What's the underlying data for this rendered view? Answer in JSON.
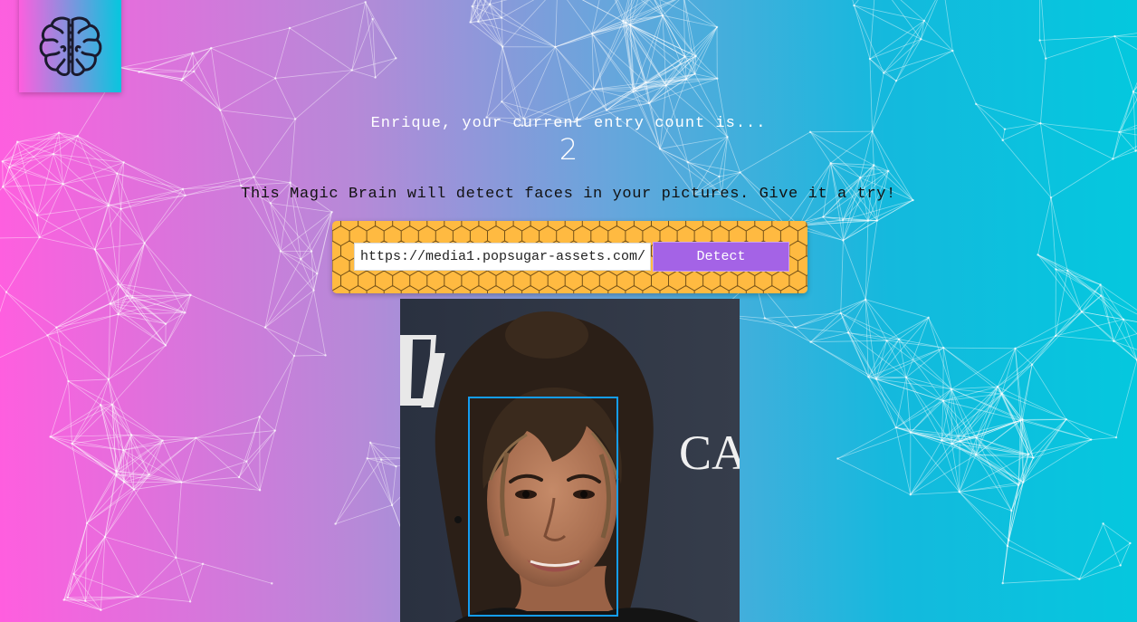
{
  "logo": {
    "icon": "brain-icon"
  },
  "greeting": {
    "prefix": "Enrique, your current entry count is..."
  },
  "entry_count": "2",
  "tagline": "This Magic Brain will detect faces in your pictures. Give it a try!",
  "form": {
    "url_value": "https://media1.popsugar-assets.com/:",
    "detect_label": "Detect"
  },
  "photo": {
    "overlay_text": "CA",
    "face_count": 1
  },
  "colors": {
    "gradient_start": "#ff5edf",
    "gradient_end": "#04c8de",
    "panel": "#ffba41",
    "button": "#a463e6",
    "box": "#149df2"
  }
}
